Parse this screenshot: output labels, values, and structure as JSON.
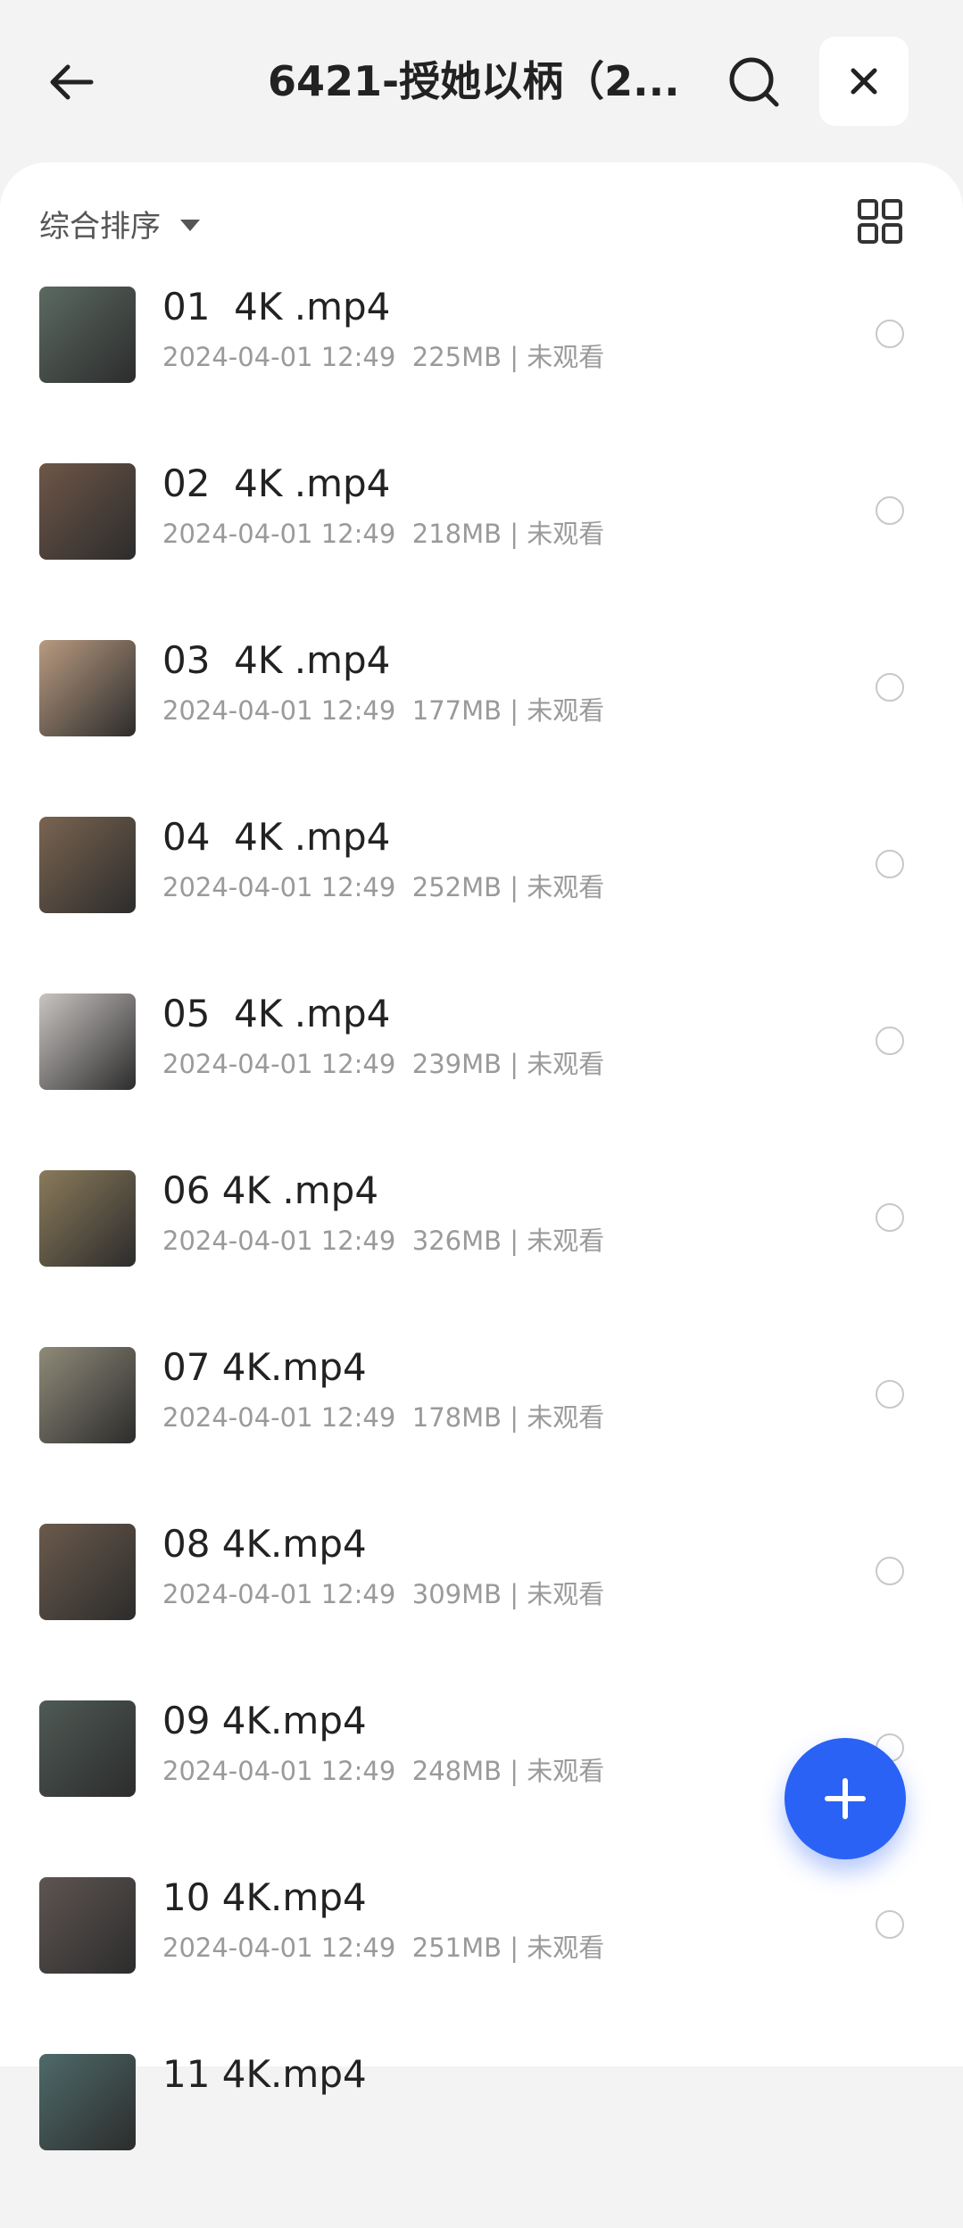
{
  "header": {
    "title": "6421-授她以柄（2...",
    "back_icon": "arrow-left-icon",
    "search_icon": "search-icon",
    "close_icon": "close-icon"
  },
  "toolbar": {
    "sort_label": "综合排序",
    "sort_icon": "caret-down-icon",
    "view_icon": "grid-view-icon"
  },
  "files": [
    {
      "name": "01  4K .mp4",
      "meta": "2024-04-01 12:49  225MB | 未观看",
      "thumb_color": "#5b6a62"
    },
    {
      "name": "02  4K .mp4",
      "meta": "2024-04-01 12:49  218MB | 未观看",
      "thumb_color": "#6e5648"
    },
    {
      "name": "03  4K .mp4",
      "meta": "2024-04-01 12:49  177MB | 未观看",
      "thumb_color": "#b89a80"
    },
    {
      "name": "04  4K .mp4",
      "meta": "2024-04-01 12:49  252MB | 未观看",
      "thumb_color": "#7a6450"
    },
    {
      "name": "05  4K .mp4",
      "meta": "2024-04-01 12:49  239MB | 未观看",
      "thumb_color": "#c9c4c2"
    },
    {
      "name": "06 4K .mp4",
      "meta": "2024-04-01 12:49  326MB | 未观看",
      "thumb_color": "#8a7a5a"
    },
    {
      "name": "07 4K.mp4",
      "meta": "2024-04-01 12:49  178MB | 未观看",
      "thumb_color": "#8f8a78"
    },
    {
      "name": "08 4K.mp4",
      "meta": "2024-04-01 12:49  309MB | 未观看",
      "thumb_color": "#6b5a4c"
    },
    {
      "name": "09 4K.mp4",
      "meta": "2024-04-01 12:49  248MB | 未观看",
      "thumb_color": "#4f5a55"
    },
    {
      "name": "10 4K.mp4",
      "meta": "2024-04-01 12:49  251MB | 未观看",
      "thumb_color": "#5e5552"
    },
    {
      "name": "11 4K.mp4",
      "meta": "",
      "thumb_color": "#4e6a6a"
    }
  ],
  "fab": {
    "icon": "plus-icon",
    "color": "#2a62f5"
  }
}
